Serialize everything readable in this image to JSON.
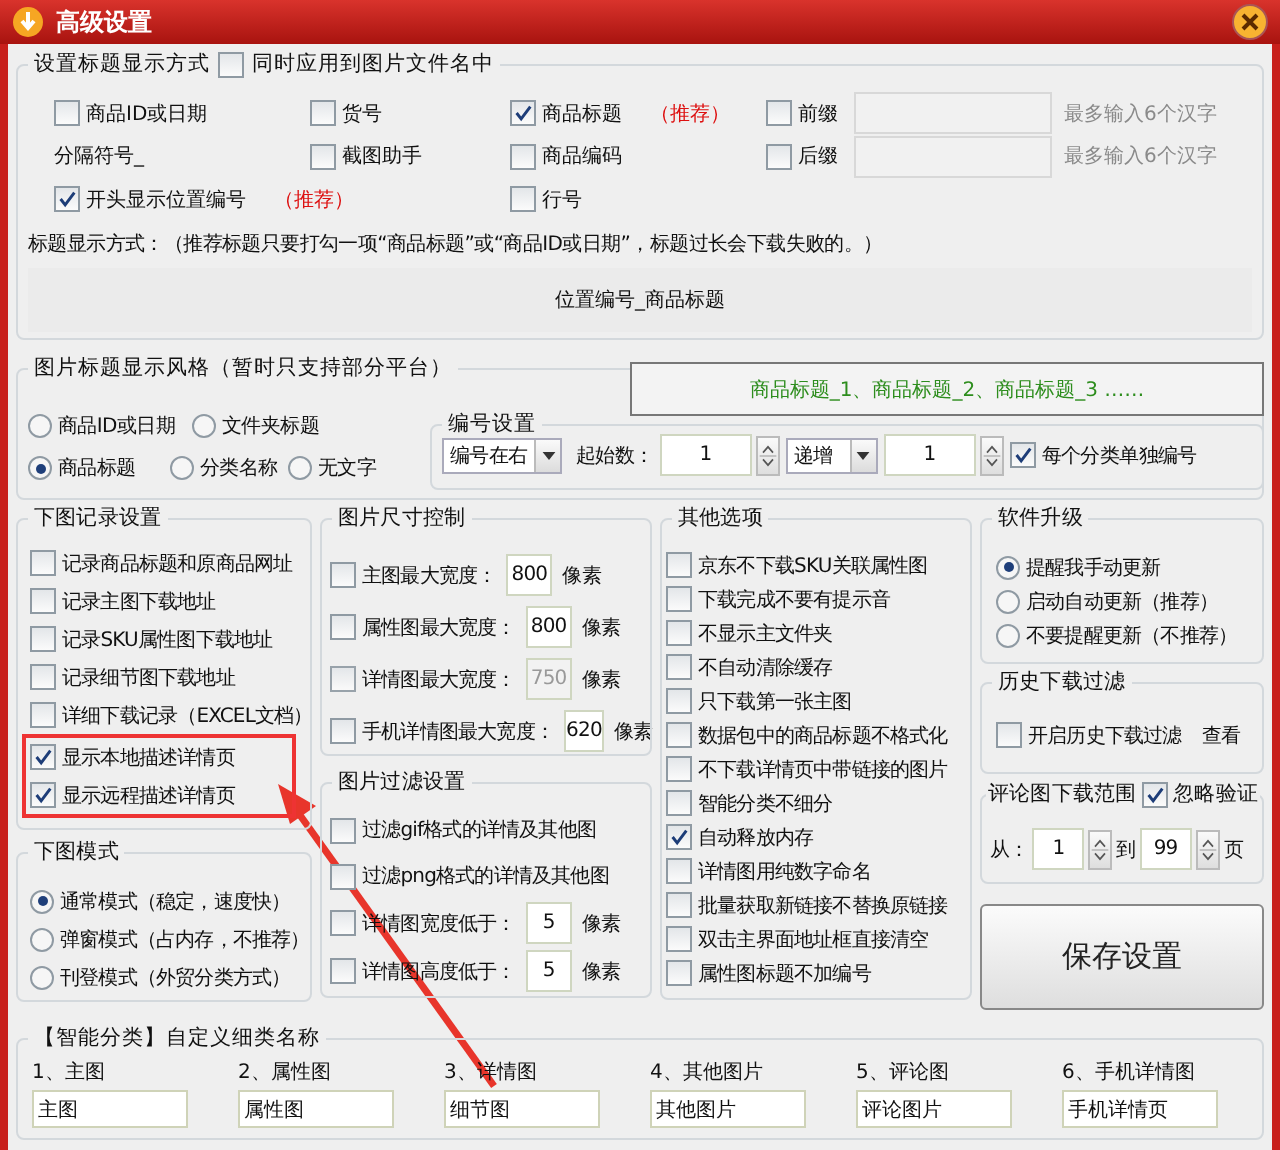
{
  "window": {
    "title": "高级设置"
  },
  "title_format": {
    "title": "设置标题显示方式",
    "apply_to_filename": {
      "label": "同时应用到图片文件名中",
      "checked": false
    },
    "rows": [
      [
        {
          "kind": "checkbox",
          "label": "商品ID或日期",
          "checked": false
        },
        {
          "kind": "checkbox",
          "label": "货号",
          "checked": false
        },
        {
          "kind": "checkbox",
          "label": "商品标题",
          "checked": true,
          "tag": "（推荐）"
        },
        {
          "kind": "affix",
          "label": "前缀",
          "checked": false,
          "hint": "最多输入6个汉字"
        }
      ],
      [
        {
          "kind": "text",
          "label": "分隔符号_"
        },
        {
          "kind": "checkbox",
          "label": "截图助手",
          "checked": false
        },
        {
          "kind": "checkbox",
          "label": "商品编码",
          "checked": false
        },
        {
          "kind": "affix",
          "label": "后缀",
          "checked": false,
          "hint": "最多输入6个汉字"
        }
      ],
      [
        {
          "kind": "checkbox",
          "label": "开头显示位置编号",
          "checked": true,
          "tag": "（推荐）"
        },
        null,
        {
          "kind": "checkbox",
          "label": "行号",
          "checked": false
        },
        null
      ]
    ],
    "description": "标题显示方式：（推荐标题只要打勾一项“商品标题”或“商品ID或日期”，标题过长会下载失败的。）",
    "preview": "位置编号_商品标题"
  },
  "caption_style": {
    "title": "图片标题显示风格（暂时只支持部分平台）",
    "rows": [
      [
        {
          "label": "商品ID或日期",
          "selected": false
        },
        {
          "label": "文件夹标题",
          "selected": false
        }
      ],
      [
        {
          "label": "商品标题",
          "selected": true
        },
        {
          "label": "分类名称",
          "selected": false
        },
        {
          "label": "无文字",
          "selected": false
        }
      ]
    ],
    "numbering": {
      "title": "编号设置",
      "preview": "商品标题_1、商品标题_2、商品标题_3 ……",
      "position": "编号在右",
      "start_label": "起始数：",
      "start": "1",
      "direction": "递增",
      "step": "1",
      "per_category": {
        "label": "每个分类单独编号",
        "checked": true
      }
    }
  },
  "download_log": {
    "title": "下图记录设置",
    "items": [
      {
        "label": "记录商品标题和原商品网址",
        "checked": false,
        "highlighted": false
      },
      {
        "label": "记录主图下载地址",
        "checked": false,
        "highlighted": false
      },
      {
        "label": "记录SKU属性图下载地址",
        "checked": false,
        "highlighted": false
      },
      {
        "label": "记录细节图下载地址",
        "checked": false,
        "highlighted": false
      },
      {
        "label": "详细下载记录（EXCEL文档）",
        "checked": false,
        "highlighted": false
      },
      {
        "label": "显示本地描述详情页",
        "checked": true,
        "highlighted": true
      },
      {
        "label": "显示远程描述详情页",
        "checked": true,
        "highlighted": true
      }
    ]
  },
  "download_mode": {
    "title": "下图模式",
    "options": [
      {
        "label": "通常模式（稳定，速度快）",
        "selected": true
      },
      {
        "label": "弹窗模式（占内存，不推荐）",
        "selected": false
      },
      {
        "label": "刊登模式（外贸分类方式）",
        "selected": false
      }
    ]
  },
  "size_control": {
    "title": "图片尺寸控制",
    "items": [
      {
        "label": "主图最大宽度：",
        "checked": false,
        "value": "800",
        "unit": "像素",
        "disabled": false
      },
      {
        "label": "属性图最大宽度：",
        "checked": false,
        "value": "800",
        "unit": "像素",
        "disabled": false
      },
      {
        "label": "详情图最大宽度：",
        "checked": false,
        "value": "750",
        "unit": "像素",
        "disabled": true
      },
      {
        "label": "手机详情图最大宽度：",
        "checked": false,
        "value": "620",
        "unit": "像素",
        "disabled": false
      }
    ]
  },
  "filters": {
    "title": "图片过滤设置",
    "items": [
      {
        "kind": "checkbox",
        "label": "过滤gif格式的详情及其他图",
        "checked": false
      },
      {
        "kind": "checkbox",
        "label": "过滤png格式的详情及其他图",
        "checked": false
      },
      {
        "kind": "threshold",
        "label": "详情图宽度低于：",
        "checked": false,
        "value": "5",
        "unit": "像素"
      },
      {
        "kind": "threshold",
        "label": "详情图高度低于：",
        "checked": false,
        "value": "5",
        "unit": "像素"
      }
    ]
  },
  "other_options": {
    "title": "其他选项",
    "items": [
      {
        "label": "京东不下载SKU关联属性图",
        "checked": false
      },
      {
        "label": "下载完成不要有提示音",
        "checked": false
      },
      {
        "label": "不显示主文件夹",
        "checked": false
      },
      {
        "label": "不自动清除缓存",
        "checked": false
      },
      {
        "label": "只下载第一张主图",
        "checked": false
      },
      {
        "label": "数据包中的商品标题不格式化",
        "checked": false
      },
      {
        "label": "不下载详情页中带链接的图片",
        "checked": false
      },
      {
        "label": "智能分类不细分",
        "checked": false
      },
      {
        "label": "自动释放内存",
        "checked": true
      },
      {
        "label": "详情图用纯数字命名",
        "checked": false
      },
      {
        "label": "批量获取新链接不替换原链接",
        "checked": false
      },
      {
        "label": "双击主界面地址框直接清空",
        "checked": false
      },
      {
        "label": "属性图标题不加编号",
        "checked": false
      }
    ]
  },
  "upgrade": {
    "title": "软件升级",
    "options": [
      {
        "label": "提醒我手动更新",
        "selected": true
      },
      {
        "label": "启动自动更新（推荐）",
        "selected": false
      },
      {
        "label": "不要提醒更新（不推荐）",
        "selected": false
      }
    ]
  },
  "history_filter": {
    "title": "历史下载过滤",
    "enable": {
      "label": "开启历史下载过滤",
      "checked": false
    },
    "view_link": "查看"
  },
  "review_range": {
    "title": "评论图下载范围",
    "ignore": {
      "label": "忽略验证",
      "checked": true
    },
    "from_label": "从：",
    "from": "1",
    "to_label": "到",
    "to": "99",
    "unit": "页"
  },
  "save_button": "保存设置",
  "smart_categories": {
    "title": "【智能分类】自定义细类名称",
    "fields": [
      {
        "label": "1、主图",
        "value": "主图"
      },
      {
        "label": "2、属性图",
        "value": "属性图"
      },
      {
        "label": "3、详情图",
        "value": "细节图"
      },
      {
        "label": "4、其他图片",
        "value": "其他图片"
      },
      {
        "label": "5、评论图",
        "value": "评论图片"
      },
      {
        "label": "6、手机详情图",
        "value": "手机详情页"
      }
    ]
  }
}
